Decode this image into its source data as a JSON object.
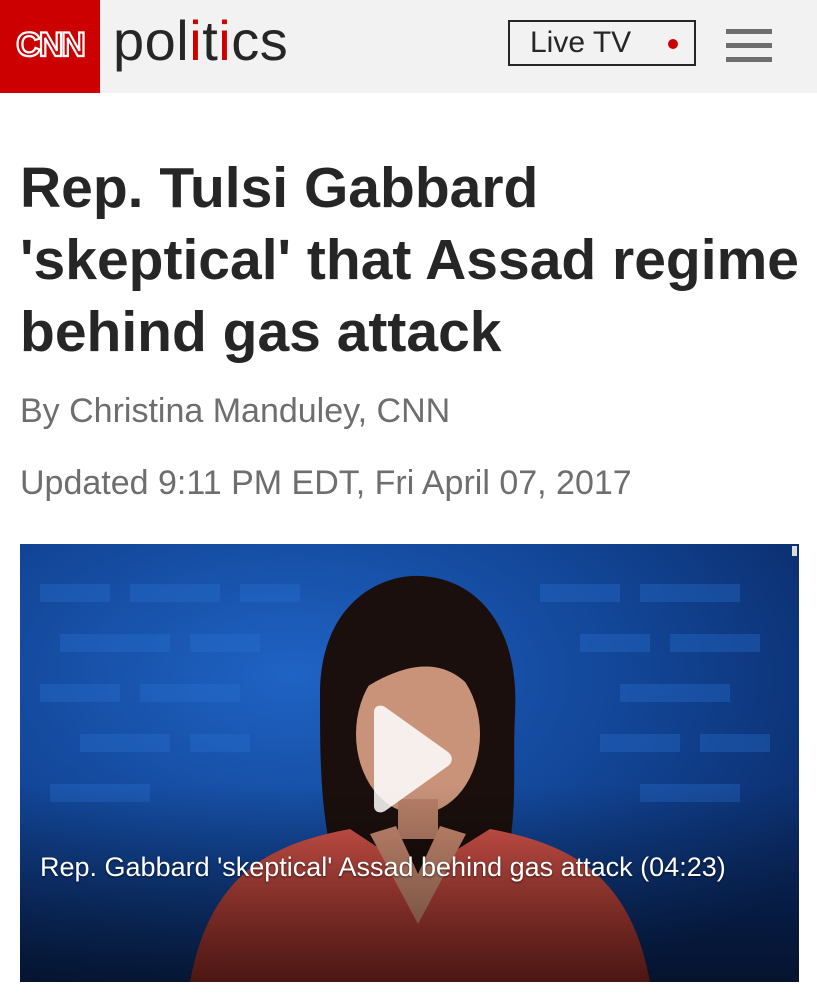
{
  "header": {
    "logo_text": "CNN",
    "section_prefix": "pol",
    "section_accent": "i",
    "section_mid": "t",
    "section_accent2": "i",
    "section_suffix": "cs",
    "live_tv_label": "Live TV",
    "menu_icon": "hamburger-menu-icon",
    "colors": {
      "brand_red": "#cc0000",
      "header_bg": "#f2f2f2",
      "text_dark": "#262626"
    }
  },
  "article": {
    "headline": "Rep. Tulsi Gabbard 'skeptical' that Assad regime behind gas attack",
    "byline": "By Christina Manduley, CNN",
    "updated": "Updated 9:11 PM EDT, Fri April 07, 2017"
  },
  "video": {
    "caption": "Rep. Gabbard 'skeptical' Assad behind gas attack (04:23)",
    "play_icon": "play-icon"
  }
}
